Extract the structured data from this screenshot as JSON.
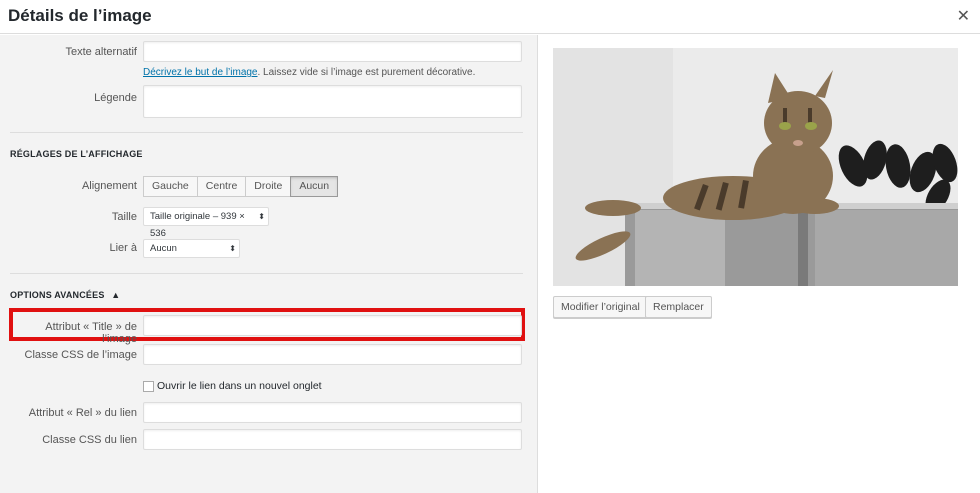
{
  "header": {
    "title": "Détails de l’image"
  },
  "alt": {
    "label": "Texte alternatif",
    "value": "",
    "help_link": "Décrivez le but de l’image",
    "help_rest": ". Laissez vide si l’image est purement décorative."
  },
  "caption": {
    "label": "Légende",
    "value": ""
  },
  "display": {
    "section_title": "RÉGLAGES DE L’AFFICHAGE",
    "alignment_label": "Alignement",
    "alignment_options": [
      "Gauche",
      "Centre",
      "Droite",
      "Aucun"
    ],
    "alignment_selected": "Aucun",
    "size_label": "Taille",
    "size_value": "Taille originale – 939 × 536",
    "link_label": "Lier à",
    "link_value": "Aucun"
  },
  "advanced": {
    "section_title": "OPTIONS AVANCÉES",
    "toggle_glyph": "▲",
    "title_attr_label": "Attribut « Title » de l’image",
    "css_class_label": "Classe CSS de l’image",
    "new_tab_label": "Ouvrir le lien dans un nouvel onglet",
    "rel_label": "Attribut « Rel » du lien",
    "link_css_label": "Classe CSS du lien"
  },
  "preview": {
    "edit_original": "Modifier l’original",
    "replace": "Remplacer"
  },
  "icons": {
    "close": "close-icon",
    "select_arrow": "select-arrow-icon"
  },
  "colors": {
    "highlight": "#e01010",
    "link": "#0073aa"
  }
}
